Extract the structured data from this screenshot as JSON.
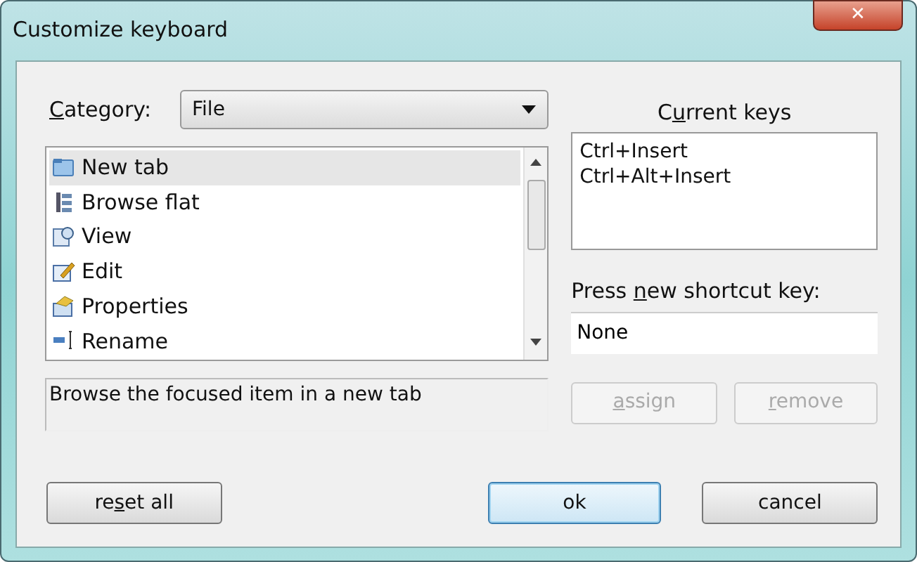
{
  "window": {
    "title": "Customize keyboard",
    "close_label": "✕"
  },
  "category": {
    "label": {
      "key": "C",
      "after": "ategory:"
    },
    "value": "File"
  },
  "commands": [
    {
      "label": "New tab",
      "selected": true
    },
    {
      "label": "Browse flat",
      "selected": false
    },
    {
      "label": "View",
      "selected": false
    },
    {
      "label": "Edit",
      "selected": false
    },
    {
      "label": "Properties",
      "selected": false
    },
    {
      "label": "Rename",
      "selected": false
    }
  ],
  "description": "Browse the focused item in a new tab",
  "current_keys": {
    "label": {
      "before": "C",
      "key": "u",
      "after": "rrent keys"
    },
    "keys": [
      "Ctrl+Insert",
      "Ctrl+Alt+Insert"
    ]
  },
  "new_shortcut": {
    "label": {
      "before": "Press ",
      "key": "n",
      "after": "ew shortcut key:"
    },
    "value": "None"
  },
  "key_buttons": [
    {
      "label": {
        "key": "a",
        "after": "ssign"
      },
      "disabled": true,
      "default": false
    },
    {
      "label": {
        "key": "r",
        "after": "emove"
      },
      "disabled": true,
      "default": false
    }
  ],
  "bottom_buttons": [
    {
      "label": {
        "before": "re",
        "key": "s",
        "after": "et all"
      },
      "disabled": false,
      "default": false
    },
    {
      "label": {
        "after": "ok"
      },
      "disabled": false,
      "default": true
    },
    {
      "label": {
        "after": "cancel"
      },
      "disabled": false,
      "default": false
    }
  ]
}
